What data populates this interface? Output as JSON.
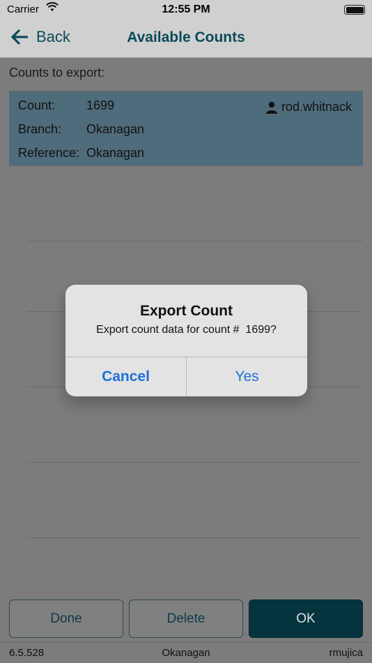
{
  "status_bar": {
    "carrier": "Carrier",
    "time": "12:55 PM"
  },
  "nav": {
    "back_label": "Back",
    "title": "Available Counts"
  },
  "content": {
    "section_label": "Counts to export:",
    "count_card": {
      "count_key": "Count:",
      "count_value": "1699",
      "branch_key": "Branch:",
      "branch_value": "Okanagan",
      "reference_key": "Reference:",
      "reference_value": "Okanagan",
      "user": "rod.whitnack"
    }
  },
  "alert": {
    "title": "Export Count",
    "message": "Export count data for count #  1699?",
    "cancel_label": "Cancel",
    "yes_label": "Yes"
  },
  "buttons": {
    "done": "Done",
    "delete": "Delete",
    "ok": "OK"
  },
  "footer": {
    "version": "6.5.528",
    "branch": "Okanagan",
    "user": "rmujica"
  },
  "colors": {
    "accent": "#0c4a5a",
    "ok_button": "#05343f",
    "alert_link": "#1d6fd8",
    "card_selected": "#4f6c7c"
  }
}
